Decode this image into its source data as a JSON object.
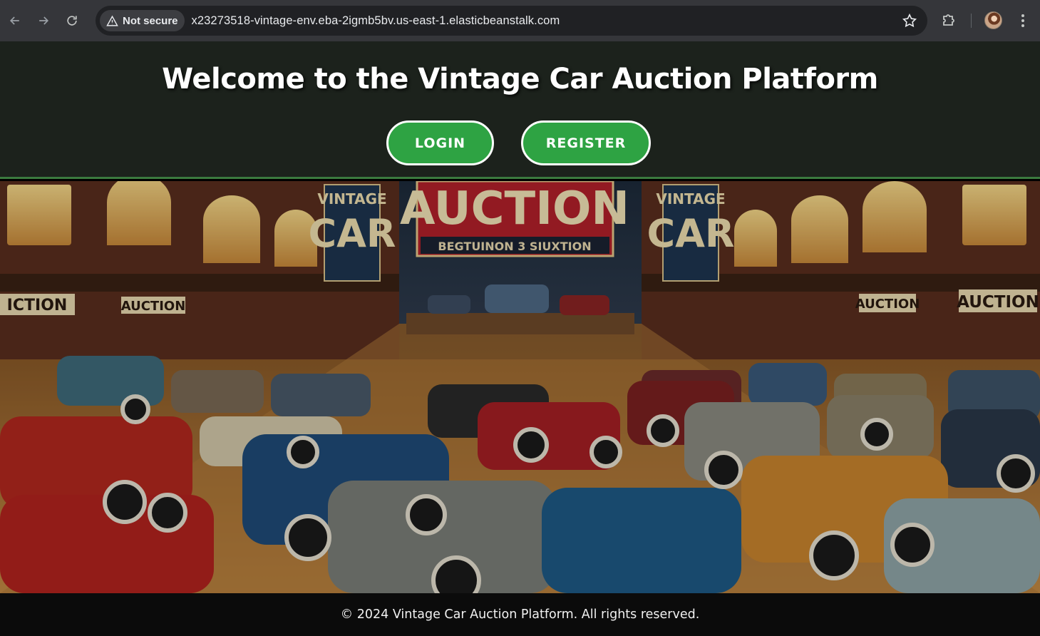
{
  "browser": {
    "security_label": "Not secure",
    "url": "x23273518-vintage-env.eba-2igmb5bv.us-east-1.elasticbeanstalk.com",
    "icons": {
      "back": "arrow-left-icon",
      "forward": "arrow-right-icon",
      "reload": "reload-icon",
      "security": "warning-triangle-icon",
      "bookmark": "star-icon",
      "extensions": "puzzle-icon",
      "profile": "avatar",
      "menu": "kebab-menu-icon"
    }
  },
  "header": {
    "title": "Welcome to the Vintage Car Auction Platform",
    "login_label": "LOGIN",
    "register_label": "REGISTER"
  },
  "hero": {
    "center_banner": "AUCTION",
    "center_banner_sub": "BEGTUINON 3 SIUXTION",
    "left_sign_line1": "VINTAGE",
    "left_sign_line2": "CAR",
    "right_sign_line1": "VINTAGE",
    "right_sign_line2": "CAR",
    "left_wall_signs": [
      "ICTION",
      "AUCTION"
    ],
    "right_wall_signs": [
      "AUCTION",
      "AUCTION"
    ]
  },
  "footer": {
    "text": "© 2024 Vintage Car Auction Platform. All rights reserved."
  },
  "colors": {
    "chrome_bg": "#35363a",
    "omnibox_bg": "#202124",
    "header_bg": "#1c221c",
    "header_border": "#3b7a3e",
    "button_bg": "#2ea343",
    "button_border": "#ffffff",
    "footer_bg": "#0b0b0b",
    "banner_red": "#b3202a"
  }
}
